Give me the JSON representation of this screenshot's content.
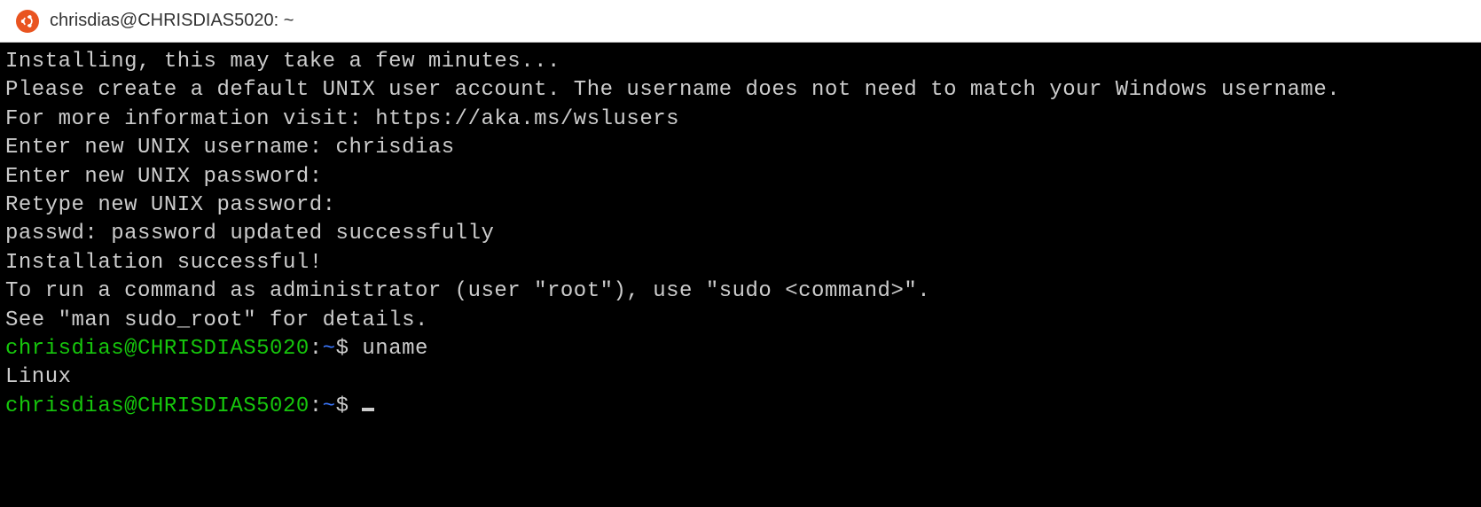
{
  "titlebar": {
    "title": "chrisdias@CHRISDIAS5020: ~",
    "icon": "ubuntu-icon"
  },
  "terminal": {
    "lines": {
      "l0": "Installing, this may take a few minutes...",
      "l1": "Please create a default UNIX user account. The username does not need to match your Windows username.",
      "l2": "For more information visit: https://aka.ms/wslusers",
      "l3": "Enter new UNIX username: chrisdias",
      "l4": "Enter new UNIX password:",
      "l5": "Retype new UNIX password:",
      "l6": "passwd: password updated successfully",
      "l7": "Installation successful!",
      "l8": "To run a command as administrator (user \"root\"), use \"sudo <command>\".",
      "l9": "See \"man sudo_root\" for details.",
      "blank": ""
    },
    "prompt1": {
      "userhost": "chrisdias@CHRISDIAS5020",
      "sep1": ":",
      "path": "~",
      "sep2": "$ ",
      "command": "uname"
    },
    "output1": "Linux",
    "prompt2": {
      "userhost": "chrisdias@CHRISDIAS5020",
      "sep1": ":",
      "path": "~",
      "sep2": "$ ",
      "command": ""
    }
  }
}
